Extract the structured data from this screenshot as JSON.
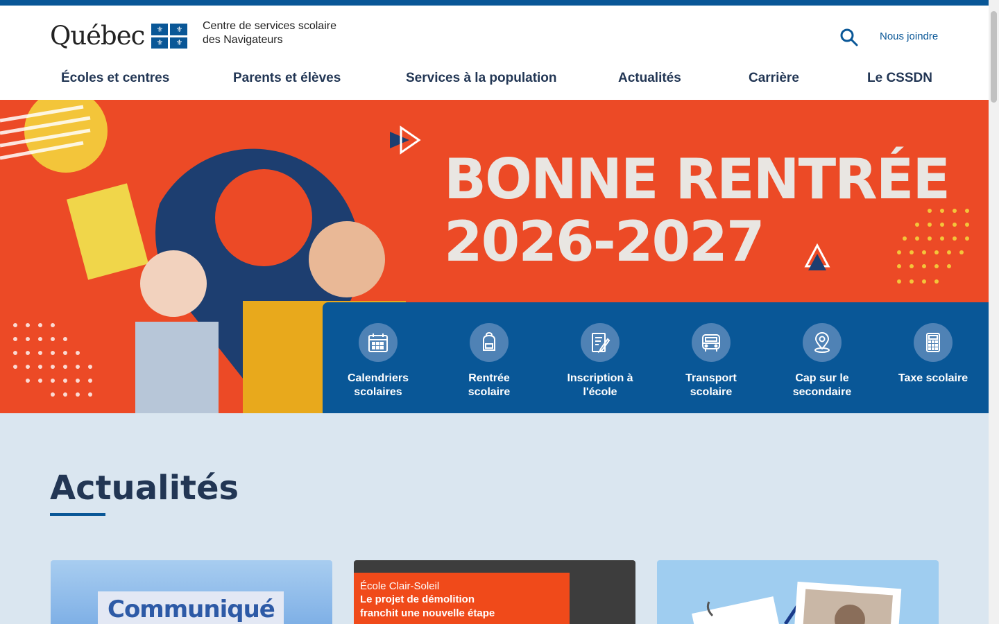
{
  "header": {
    "brand": "Québec",
    "org_line1": "Centre de services scolaire",
    "org_line2": "des Navigateurs",
    "contact_label": "Nous joindre"
  },
  "nav": {
    "items": [
      {
        "label": "Écoles et centres"
      },
      {
        "label": "Parents et élèves"
      },
      {
        "label": "Services à la population"
      },
      {
        "label": "Actualités"
      },
      {
        "label": "Carrière"
      },
      {
        "label": "Le CSSDN"
      }
    ]
  },
  "hero": {
    "line1": "BONNE RENTRÉE",
    "line2": "2026-2027"
  },
  "quick_links": [
    {
      "line1": "Calendriers",
      "line2": "scolaires",
      "icon": "calendar-icon"
    },
    {
      "line1": "Rentrée",
      "line2": "scolaire",
      "icon": "backpack-icon"
    },
    {
      "line1": "Inscription à",
      "line2": "l'école",
      "icon": "form-edit-icon"
    },
    {
      "line1": "Transport",
      "line2": "scolaire",
      "icon": "bus-icon"
    },
    {
      "line1": "Cap sur le",
      "line2": "secondaire",
      "icon": "map-pin-icon"
    },
    {
      "line1": "Taxe scolaire",
      "line2": "",
      "icon": "calculator-icon"
    }
  ],
  "news": {
    "title": "Actualités",
    "cards": [
      {
        "headline": "Communiqué"
      },
      {
        "school": "École Clair-Soleil",
        "headline_line1": "Le projet de démolition",
        "headline_line2": "franchit une nouvelle étape"
      },
      {
        "headline": ""
      }
    ]
  },
  "colors": {
    "primary": "#095797",
    "hero_bg": "#ec4a26",
    "section_bg": "#dae6f0",
    "nav_text": "#223654"
  }
}
